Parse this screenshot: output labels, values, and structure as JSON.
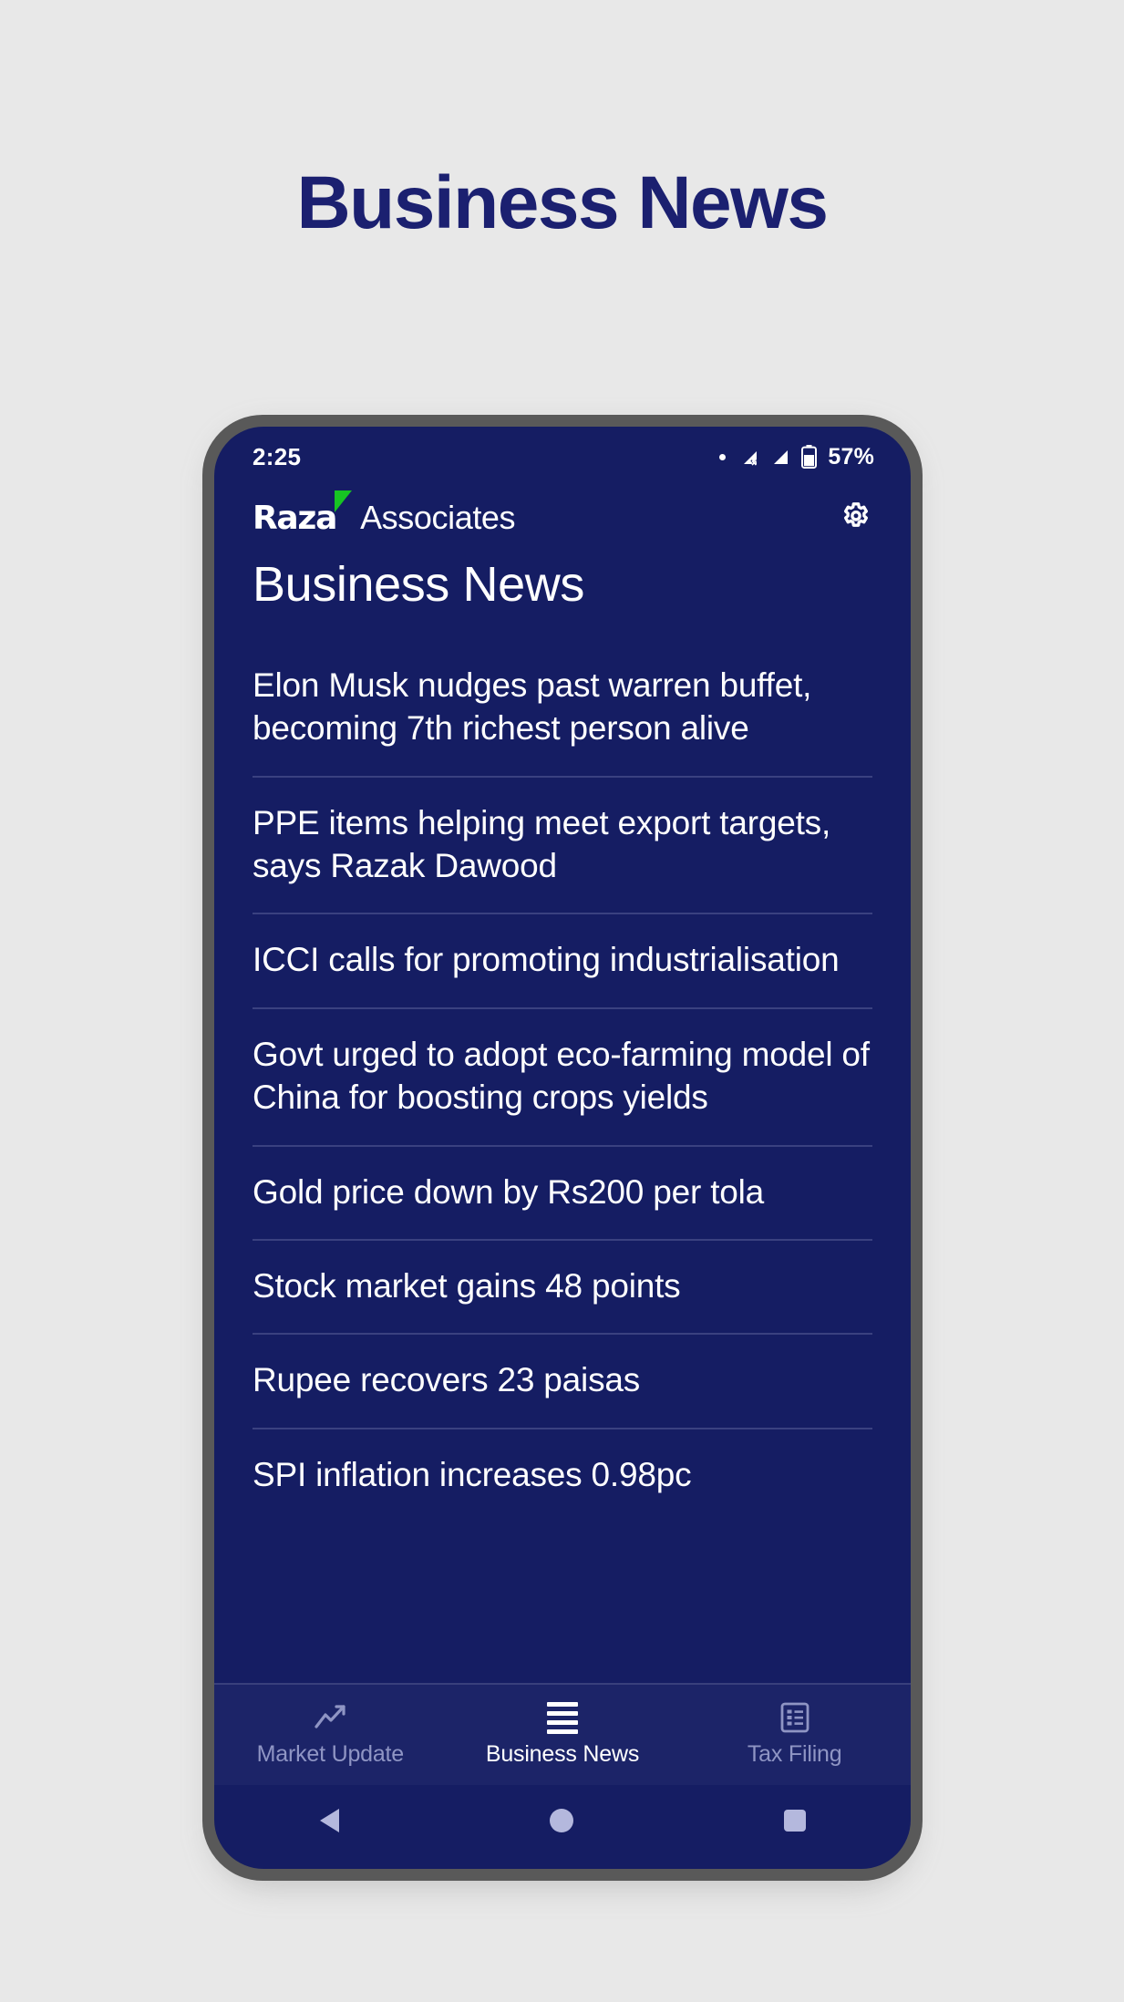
{
  "page": {
    "heading": "Business News",
    "background_color": "#e8e8e8",
    "heading_color": "#1b2070"
  },
  "device": {
    "frame_color": "#595959",
    "screen_color": "#151d63"
  },
  "status_bar": {
    "time": "2:25",
    "dot_icon": "dot-icon",
    "signal_no_service_icon": "signal-no-service-icon",
    "signal_icon": "signal-icon",
    "battery_icon": "battery-icon",
    "battery_percent": "57%"
  },
  "app_bar": {
    "brand_primary": "Raza",
    "brand_secondary": "Associates",
    "brand_accent_color": "#17c423",
    "settings_icon": "gear-icon"
  },
  "app": {
    "title": "Business News",
    "news_items": [
      "Elon Musk nudges past warren buffet, becoming 7th richest person alive",
      "PPE items helping meet export targets, says Razak Dawood",
      "ICCI calls for promoting industrialisation",
      "Govt urged to adopt eco-farming model of China for boosting crops yields",
      "Gold price down by Rs200 per tola",
      "Stock market gains 48 points",
      "Rupee recovers 23 paisas",
      "SPI inflation increases 0.98pc"
    ]
  },
  "tab_bar": {
    "tabs": [
      {
        "label": "Market Update",
        "icon": "trending-up-icon",
        "active": false
      },
      {
        "label": "Business News",
        "icon": "list-lines-icon",
        "active": true
      },
      {
        "label": "Tax Filing",
        "icon": "document-list-icon",
        "active": false
      }
    ],
    "active_color": "#ffffff",
    "inactive_color": "#8f95c4"
  },
  "android_nav": {
    "back_icon": "triangle-back-icon",
    "home_icon": "circle-home-icon",
    "recents_icon": "square-recents-icon",
    "icon_color": "#b4b8dd"
  }
}
